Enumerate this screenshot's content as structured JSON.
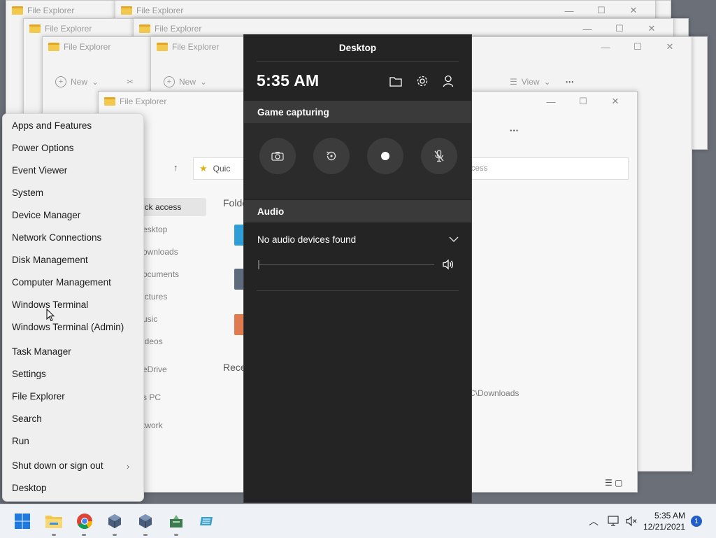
{
  "explorer_windows": {
    "title": "File Explorer",
    "new_label": "New",
    "view_label": "View",
    "back_window": {
      "nav_items": [
        "ick access",
        "esktop",
        "ownloads",
        "ocuments",
        "ictures",
        "usic",
        "ideos",
        "eDrive",
        "s PC",
        "twork"
      ],
      "address_partial": "Quic",
      "search_partial": "ccess",
      "folders_label": "Folde",
      "recent_label": "Rece",
      "recent_path_partial": "C\\Downloads"
    }
  },
  "context_menu": {
    "items": [
      {
        "label": "Apps and Features"
      },
      {
        "label": "Power Options"
      },
      {
        "label": "Event Viewer"
      },
      {
        "label": "System"
      },
      {
        "label": "Device Manager"
      },
      {
        "label": "Network Connections"
      },
      {
        "label": "Disk Management"
      },
      {
        "label": "Computer Management"
      },
      {
        "label": "Windows Terminal"
      },
      {
        "label": "Windows Terminal (Admin)"
      },
      {
        "label": "Task Manager"
      },
      {
        "label": "Settings"
      },
      {
        "label": "File Explorer"
      },
      {
        "label": "Search"
      },
      {
        "label": "Run"
      },
      {
        "label": "Shut down or sign out"
      },
      {
        "label": "Desktop"
      }
    ],
    "submenu_icon": "chevron-right-icon"
  },
  "game_bar": {
    "title": "Desktop",
    "time": "5:35 AM",
    "header_icons": [
      "folder-icon",
      "gear-icon",
      "user-icon"
    ],
    "capture_section_label": "Game capturing",
    "capture_buttons": [
      "screenshot-icon",
      "record-last-icon",
      "record-dot-icon",
      "mic-off-icon"
    ],
    "audio_section_label": "Audio",
    "audio_device_text": "No audio devices found",
    "volume_icon": "speaker-icon"
  },
  "taskbar": {
    "apps": [
      "start-icon",
      "file-explorer-icon",
      "chrome-icon",
      "virtualbox-icon",
      "virtualbox-icon",
      "app-icon",
      "app-icon"
    ],
    "clock_time": "5:35 AM",
    "clock_date": "12/21/2021",
    "notification_count": "1"
  },
  "colors": {
    "game_bar_bg": "#242424",
    "section_header_bg": "#3a3a3a",
    "menu_bg": "#efefef",
    "accent": "#1f5fc7"
  }
}
